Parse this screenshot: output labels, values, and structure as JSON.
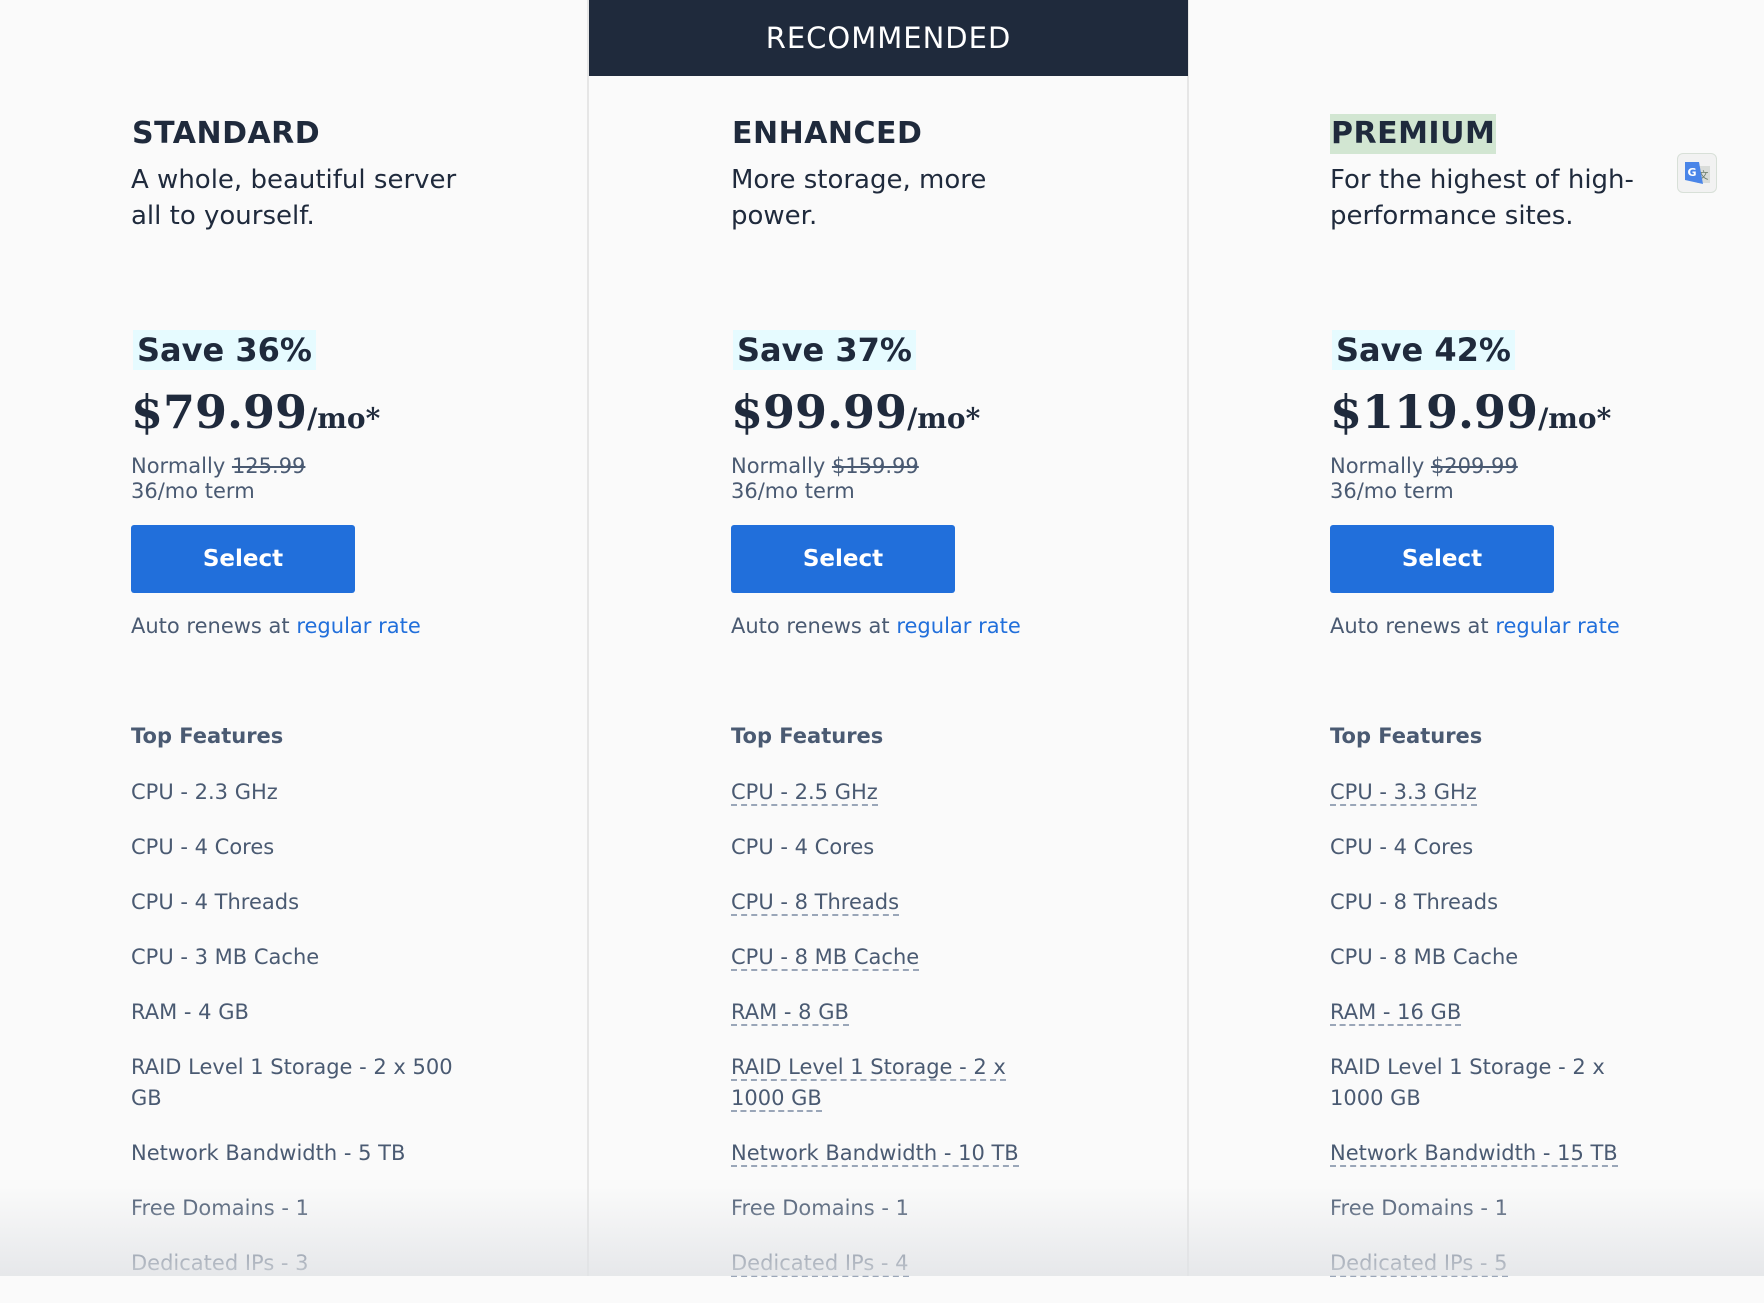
{
  "banner": {
    "label": "RECOMMENDED"
  },
  "plans": [
    {
      "name": "STANDARD",
      "description": "A whole, beautiful server all to yourself.",
      "save": "Save 36%",
      "price": "$79.99",
      "per": "/mo*",
      "normally_label": "Normally",
      "normally_price": "125.99",
      "term": "36/mo term",
      "select_label": "Select",
      "renew_prefix": "Auto renews at",
      "renew_link": "regular rate",
      "features_heading": "Top Features",
      "features": [
        {
          "text": "CPU - 2.3 GHz",
          "tooltip": false
        },
        {
          "text": "CPU - 4 Cores",
          "tooltip": false
        },
        {
          "text": "CPU - 4 Threads",
          "tooltip": false
        },
        {
          "text": "CPU - 3 MB Cache",
          "tooltip": false
        },
        {
          "text": "RAM - 4 GB",
          "tooltip": false
        },
        {
          "text": "RAID Level 1 Storage - 2 x 500 GB",
          "tooltip": false
        },
        {
          "text": "Network Bandwidth - 5 TB",
          "tooltip": false
        },
        {
          "text": "Free Domains - 1",
          "tooltip": false
        },
        {
          "text": "Dedicated IPs - 3",
          "tooltip": false
        }
      ]
    },
    {
      "name": "ENHANCED",
      "description": "More storage, more power.",
      "save": "Save 37%",
      "price": "$99.99",
      "per": "/mo*",
      "normally_label": "Normally",
      "normally_price": "$159.99",
      "term": "36/mo term",
      "select_label": "Select",
      "renew_prefix": "Auto renews at",
      "renew_link": "regular rate",
      "features_heading": "Top Features",
      "features": [
        {
          "text": "CPU - 2.5 GHz",
          "tooltip": true
        },
        {
          "text": "CPU - 4 Cores",
          "tooltip": false
        },
        {
          "text": "CPU - 8 Threads",
          "tooltip": true
        },
        {
          "text": "CPU - 8 MB Cache",
          "tooltip": true
        },
        {
          "text": "RAM - 8 GB",
          "tooltip": true
        },
        {
          "text": "RAID Level 1 Storage - 2 x 1000 GB",
          "tooltip": true
        },
        {
          "text": "Network Bandwidth - 10 TB",
          "tooltip": true
        },
        {
          "text": "Free Domains - 1",
          "tooltip": false
        },
        {
          "text": "Dedicated IPs - 4",
          "tooltip": true
        }
      ]
    },
    {
      "name": "PREMIUM",
      "description": "For the highest of high-performance sites.",
      "save": "Save 42%",
      "price": "$119.99",
      "per": "/mo*",
      "normally_label": "Normally",
      "normally_price": "$209.99",
      "term": "36/mo term",
      "select_label": "Select",
      "renew_prefix": "Auto renews at",
      "renew_link": "regular rate",
      "features_heading": "Top Features",
      "features": [
        {
          "text": "CPU - 3.3 GHz",
          "tooltip": true
        },
        {
          "text": "CPU - 4 Cores",
          "tooltip": false
        },
        {
          "text": "CPU - 8 Threads",
          "tooltip": false
        },
        {
          "text": "CPU - 8 MB Cache",
          "tooltip": false
        },
        {
          "text": "RAM - 16 GB",
          "tooltip": true
        },
        {
          "text": "RAID Level 1 Storage - 2 x 1000 GB",
          "tooltip": false
        },
        {
          "text": "Network Bandwidth - 15 TB",
          "tooltip": true
        },
        {
          "text": "Free Domains - 1",
          "tooltip": false
        },
        {
          "text": "Dedicated IPs - 5",
          "tooltip": true
        }
      ]
    }
  ],
  "colors": {
    "banner_bg": "#1f2a3c",
    "button_bg": "#216fdb",
    "link": "#216fdb",
    "save_highlight": "#e6fbff",
    "premium_highlight": "#d2e6d2"
  },
  "icons": {
    "translate": "google-translate-icon"
  }
}
